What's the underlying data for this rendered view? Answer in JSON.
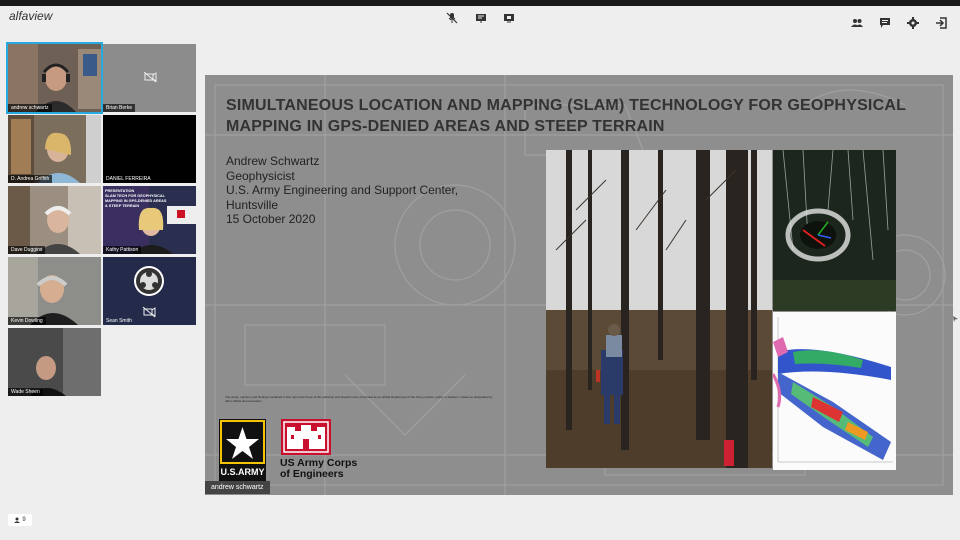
{
  "app": {
    "name": "alfaview"
  },
  "toolbar_center": [
    {
      "icon": "mic-muted-icon"
    },
    {
      "icon": "whiteboard-icon"
    },
    {
      "icon": "screen-share-icon"
    }
  ],
  "toolbar_right": [
    {
      "icon": "participants-icon"
    },
    {
      "icon": "chat-icon"
    },
    {
      "icon": "settings-icon"
    },
    {
      "icon": "leave-icon"
    }
  ],
  "participants": [
    {
      "name": "andrew schwartz",
      "selected": true
    },
    {
      "name": "Brian Berke",
      "camera_off": true
    },
    {
      "name": "D. Andrea Griffith"
    },
    {
      "name": "DANIEL FERREIRA"
    },
    {
      "name": "Dave Duggins"
    },
    {
      "name": "Kathy Pattison"
    },
    {
      "name": "Kevin Dowling"
    },
    {
      "name": "Sean Smith",
      "camera_off": true
    },
    {
      "name": "Wade Sheen"
    }
  ],
  "slide": {
    "title": "SIMULTANEOUS LOCATION AND MAPPING (SLAM) TECHNOLOGY FOR GEOPHYSICAL MAPPING IN GPS-DENIED AREAS AND STEEP TERRAIN",
    "author_lines": [
      "Andrew Schwartz",
      "Geophysicist",
      "U.S. Army Engineering and Support Center,",
      "Huntsville",
      "15 October 2020"
    ],
    "disclaimer": "The views, opinions and findings contained in this report are those of the author(s) and should not be construed as an official Department of the Army position, policy or decision, unless so designated by other official documentation.",
    "army_logo_text": "U.S.ARMY",
    "usace_text_line1": "US Army Corps",
    "usace_text_line2": "of Engineers",
    "presenter_label": "andrew schwartz"
  },
  "thumb_slide": {
    "text_lines": [
      "PRESENTATION",
      "SLAM TECH FOR GEOPHYSICAL",
      "MAPPING IN GPS-DENIED AREAS",
      "& STEEP TERRAIN"
    ]
  },
  "participant_count": "9",
  "colors": {
    "selection": "#28a9e0",
    "background": "#eeeeee",
    "slide_bg": "#8e8e8e"
  }
}
